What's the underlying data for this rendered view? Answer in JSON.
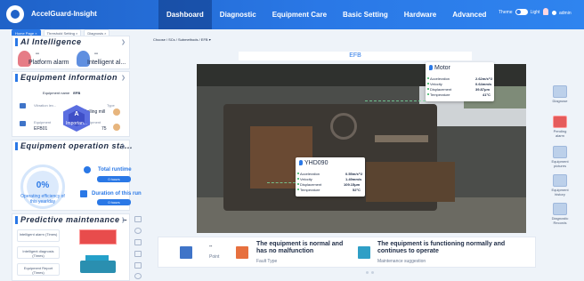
{
  "app": {
    "brand": "AccelGuard-Insight"
  },
  "nav": {
    "items": [
      "Dashboard",
      "Diagnostic",
      "Equipment Care",
      "Basic Setting",
      "Hardware",
      "Advanced"
    ],
    "active": "Dashboard"
  },
  "header": {
    "theme_label": "Theme",
    "theme_value": "Light",
    "user": "admin"
  },
  "tabs": [
    {
      "label": "Home Page ×",
      "active": true
    },
    {
      "label": "Threshold Setting ×",
      "active": false
    },
    {
      "label": "Diagnosis ×",
      "active": false
    }
  ],
  "ai": {
    "title": "AI Intelligence",
    "items": [
      {
        "value": "--",
        "label": "Platform alarm"
      },
      {
        "value": "--",
        "label": "Intelligent al..."
      }
    ]
  },
  "equipment": {
    "title": "Equipment information",
    "name_label": "Equipment name",
    "name_value": "EFB",
    "vibration_label": "Vibration lev...",
    "type_label": "Type",
    "type_value": "Rolling mill",
    "equipment_label": "Equipment",
    "equipment_value": "EFB01",
    "equipment2_label": "Equipment",
    "equipment2_value": "75",
    "grade": "A",
    "grade_label": "Importan..."
  },
  "operation": {
    "title": "Equipment operation sta...",
    "percent": "0%",
    "efficiency_label": "Operating efficiency of this year/day",
    "total_runtime_label": "Total runtime",
    "total_runtime_value": "0 hours",
    "run_label": "Duration of this run",
    "run_value": "0 hours"
  },
  "predictive": {
    "title": "Predictive maintenance –",
    "items": [
      "Intelligent alarm (Times)",
      "Intelligent diagnosis (Times)",
      "Equipment Report (Times)"
    ]
  },
  "main": {
    "breadcrumb": "Choose / SCs / Submethods / EFB ▾",
    "title": "EFB"
  },
  "motor": {
    "title": "Motor",
    "rows": [
      {
        "label": "Acceleration",
        "value": "2.62m/s^2"
      },
      {
        "label": "Velocity",
        "value": "0.64mm/s"
      },
      {
        "label": "Displacement",
        "value": "39.87μm"
      },
      {
        "label": "Temperature",
        "value": "41°C"
      }
    ]
  },
  "yhd": {
    "title": "YHD090",
    "rows": [
      {
        "label": "Acceleration",
        "value": "0.55m/s^2"
      },
      {
        "label": "Velocity",
        "value": "1.49mm/s"
      },
      {
        "label": "Displacement",
        "value": "109.15μm"
      },
      {
        "label": "Temperature",
        "value": "52°C"
      }
    ]
  },
  "right_sidebar": [
    "Diagnose",
    "Pending alarm",
    "Equipment pictures",
    "Equipment history",
    "Diagnostic Records"
  ],
  "status": {
    "point_value": "--",
    "point_label": "Point",
    "fault_title": "The equipment is normal and has no malfunction",
    "fault_label": "Fault Type",
    "maint_title": "The equipment is functioning normally and continues to operate",
    "maint_label": "Maintenance suggestion"
  },
  "colors": {
    "brand": "#2a78e6",
    "alarm": "#e84c4c",
    "ok": "#2fae5a"
  }
}
